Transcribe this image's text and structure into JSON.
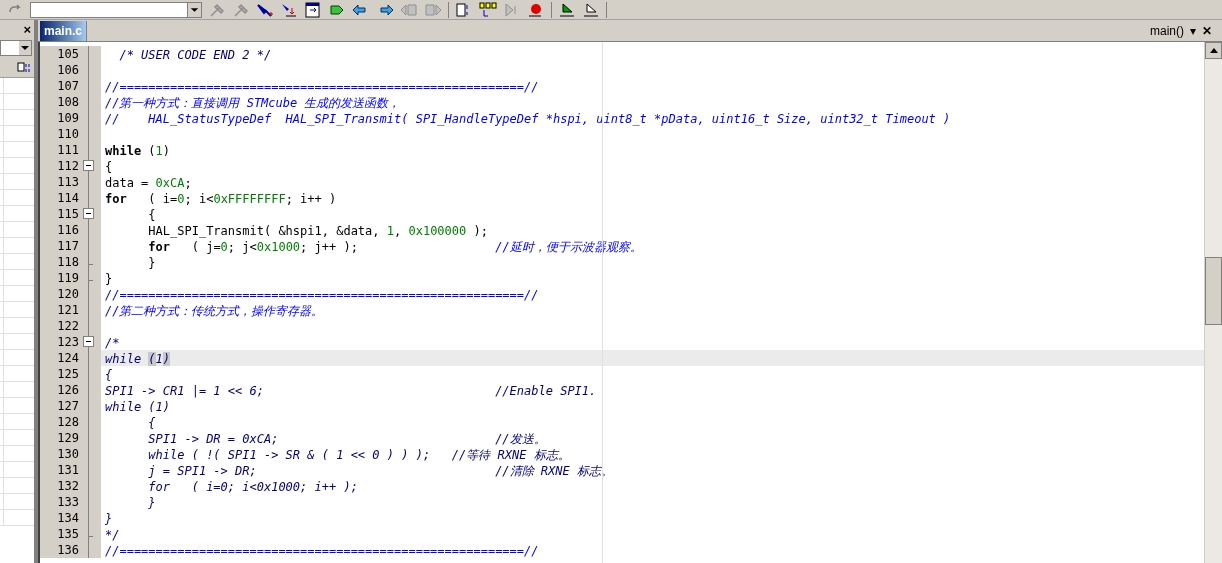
{
  "tabs": [
    {
      "label": "main.c",
      "selected": true
    }
  ],
  "function_selector": {
    "value": "main()",
    "caret": "▾",
    "close": "✕"
  },
  "side_panel": {
    "close": "×"
  },
  "lines": [
    {
      "number": "105",
      "fold_start": false,
      "fold_end": false,
      "current": false,
      "segments": [
        {
          "kind": "block",
          "text": "  /* USER CODE END 2 */"
        }
      ]
    },
    {
      "number": "106",
      "fold_start": false,
      "fold_end": false,
      "current": false
    },
    {
      "number": "107",
      "fold_start": false,
      "fold_end": false,
      "current": false,
      "segments": [
        {
          "kind": "comment",
          "text": "//========================================================//"
        }
      ]
    },
    {
      "number": "108",
      "fold_start": false,
      "fold_end": false,
      "current": false,
      "segments": [
        {
          "kind": "comment",
          "text": "//第一种方式：直接调用 STMcube 生成的发送函数，"
        }
      ]
    },
    {
      "number": "109",
      "fold_start": false,
      "fold_end": false,
      "current": false,
      "segments": [
        {
          "kind": "comment",
          "text": "//    HAL_StatusTypeDef  HAL_SPI_Transmit( SPI_HandleTypeDef *hspi, uint8_t *pData, uint16_t Size, uint32_t Timeout )"
        }
      ]
    },
    {
      "number": "110",
      "fold_start": false,
      "fold_end": false,
      "current": false
    },
    {
      "number": "111",
      "fold_start": false,
      "fold_end": false,
      "current": false,
      "segments": [
        {
          "kind": "keyword",
          "text": "while"
        },
        {
          "kind": "plain",
          "text": " ("
        },
        {
          "kind": "number",
          "text": "1"
        },
        {
          "kind": "plain",
          "text": ")"
        }
      ]
    },
    {
      "number": "112",
      "fold_start": true,
      "fold_end": false,
      "current": false,
      "segments": [
        {
          "kind": "plain",
          "text": "{"
        }
      ]
    },
    {
      "number": "113",
      "fold_start": false,
      "fold_end": false,
      "current": false,
      "segments": [
        {
          "kind": "plain",
          "text": "data = "
        },
        {
          "kind": "number",
          "text": "0xCA"
        },
        {
          "kind": "plain",
          "text": ";"
        }
      ]
    },
    {
      "number": "114",
      "fold_start": false,
      "fold_end": false,
      "current": false,
      "segments": [
        {
          "kind": "keyword",
          "text": "for"
        },
        {
          "kind": "plain",
          "text": "   ( i="
        },
        {
          "kind": "number",
          "text": "0"
        },
        {
          "kind": "plain",
          "text": "; i<"
        },
        {
          "kind": "number",
          "text": "0xFFFFFFFF"
        },
        {
          "kind": "plain",
          "text": "; i++ )"
        }
      ]
    },
    {
      "number": "115",
      "fold_start": true,
      "fold_end": false,
      "current": false,
      "segments": [
        {
          "kind": "plain",
          "text": "      {"
        }
      ]
    },
    {
      "number": "116",
      "fold_start": false,
      "fold_end": false,
      "current": false,
      "segments": [
        {
          "kind": "plain",
          "text": "      HAL_SPI_Transmit( &hspi1, &data, "
        },
        {
          "kind": "number",
          "text": "1"
        },
        {
          "kind": "plain",
          "text": ", "
        },
        {
          "kind": "number",
          "text": "0x100000"
        },
        {
          "kind": "plain",
          "text": " );"
        }
      ]
    },
    {
      "number": "117",
      "fold_start": false,
      "fold_end": false,
      "current": false,
      "segments": [
        {
          "kind": "keyword",
          "text": "      for"
        },
        {
          "kind": "plain",
          "text": "   ( j="
        },
        {
          "kind": "number",
          "text": "0"
        },
        {
          "kind": "plain",
          "text": "; j<"
        },
        {
          "kind": "number",
          "text": "0x1000"
        },
        {
          "kind": "plain",
          "text": "; j++ );                   "
        },
        {
          "kind": "comment",
          "text": "//延时，便于示波器观察。"
        }
      ]
    },
    {
      "number": "118",
      "fold_start": false,
      "fold_end": true,
      "current": false,
      "segments": [
        {
          "kind": "plain",
          "text": "      }"
        }
      ]
    },
    {
      "number": "119",
      "fold_start": false,
      "fold_end": true,
      "current": false,
      "segments": [
        {
          "kind": "plain",
          "text": "}"
        }
      ]
    },
    {
      "number": "120",
      "fold_start": false,
      "fold_end": false,
      "current": false,
      "segments": [
        {
          "kind": "comment",
          "text": "//========================================================//"
        }
      ]
    },
    {
      "number": "121",
      "fold_start": false,
      "fold_end": false,
      "current": false,
      "segments": [
        {
          "kind": "comment",
          "text": "//第二种方式：传统方式，操作寄存器。"
        }
      ]
    },
    {
      "number": "122",
      "fold_start": false,
      "fold_end": false,
      "current": false
    },
    {
      "number": "123",
      "fold_start": true,
      "fold_end": false,
      "current": false,
      "segments": [
        {
          "kind": "block",
          "text": "/*"
        }
      ]
    },
    {
      "number": "124",
      "fold_start": false,
      "fold_end": false,
      "current": true,
      "segments": [
        {
          "kind": "block",
          "text": "while "
        },
        {
          "kind": "match",
          "text": "("
        },
        {
          "kind": "block",
          "text": "1"
        },
        {
          "kind": "match",
          "text": ")"
        }
      ]
    },
    {
      "number": "125",
      "fold_start": false,
      "fold_end": false,
      "current": false,
      "segments": [
        {
          "kind": "block",
          "text": "{"
        }
      ]
    },
    {
      "number": "126",
      "fold_start": false,
      "fold_end": false,
      "current": false,
      "segments": [
        {
          "kind": "block",
          "text": "SPI1 -> CR1 |= 1 << 6;                                //Enable SPI1."
        }
      ]
    },
    {
      "number": "127",
      "fold_start": false,
      "fold_end": false,
      "current": false,
      "segments": [
        {
          "kind": "block",
          "text": "while (1)"
        }
      ]
    },
    {
      "number": "128",
      "fold_start": false,
      "fold_end": false,
      "current": false,
      "segments": [
        {
          "kind": "block",
          "text": "      {"
        }
      ]
    },
    {
      "number": "129",
      "fold_start": false,
      "fold_end": false,
      "current": false,
      "segments": [
        {
          "kind": "block",
          "text": "      SPI1 -> DR = 0xCA;                              //发送。"
        }
      ]
    },
    {
      "number": "130",
      "fold_start": false,
      "fold_end": false,
      "current": false,
      "segments": [
        {
          "kind": "block",
          "text": "      while ( !( SPI1 -> SR & ( 1 << 0 ) ) );   //等待 RXNE 标志。"
        }
      ]
    },
    {
      "number": "131",
      "fold_start": false,
      "fold_end": false,
      "current": false,
      "segments": [
        {
          "kind": "block",
          "text": "      j = SPI1 -> DR;                                 //清除 RXNE 标志。"
        }
      ]
    },
    {
      "number": "132",
      "fold_start": false,
      "fold_end": false,
      "current": false,
      "segments": [
        {
          "kind": "block",
          "text": "      for   ( i=0; i<0x1000; i++ );"
        }
      ]
    },
    {
      "number": "133",
      "fold_start": false,
      "fold_end": false,
      "current": false,
      "segments": [
        {
          "kind": "block",
          "text": "      }"
        }
      ]
    },
    {
      "number": "134",
      "fold_start": false,
      "fold_end": false,
      "current": false,
      "segments": [
        {
          "kind": "block",
          "text": "}"
        }
      ]
    },
    {
      "number": "135",
      "fold_start": false,
      "fold_end": true,
      "current": false,
      "segments": [
        {
          "kind": "block",
          "text": "*/"
        }
      ]
    },
    {
      "number": "136",
      "fold_start": false,
      "fold_end": false,
      "current": false,
      "segments": [
        {
          "kind": "comment",
          "text": "//========================================================//"
        }
      ]
    }
  ]
}
